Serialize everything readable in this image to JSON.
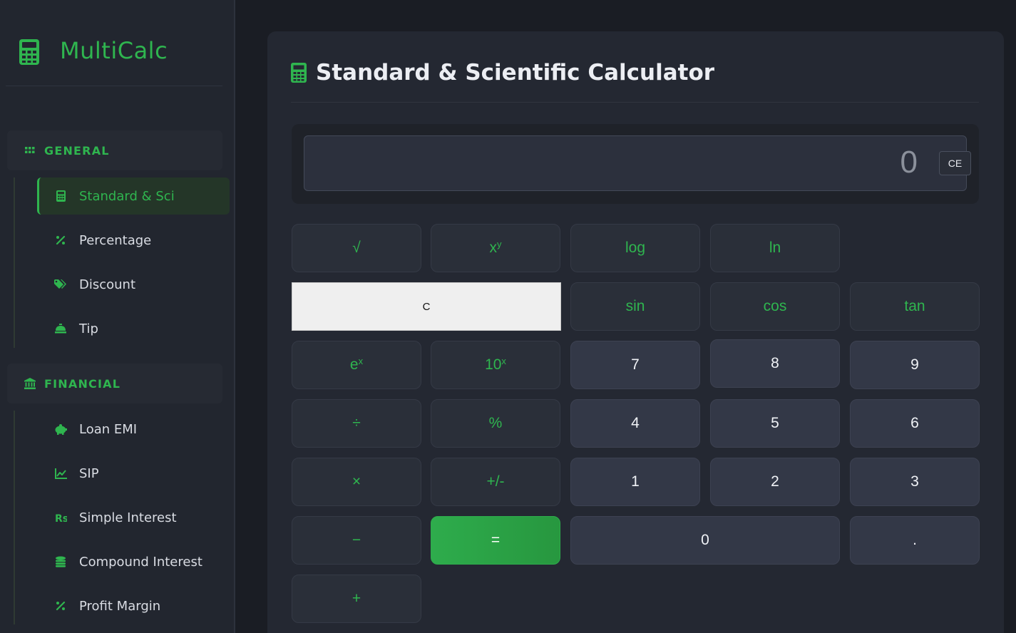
{
  "app": {
    "name": "MultiCalc"
  },
  "sidebar": {
    "sections": [
      {
        "label": "GENERAL",
        "items": [
          {
            "label": "Standard & Sci",
            "icon": "calculator-icon",
            "active": true
          },
          {
            "label": "Percentage",
            "icon": "percent-icon"
          },
          {
            "label": "Discount",
            "icon": "tags-icon"
          },
          {
            "label": "Tip",
            "icon": "bell-concierge-icon"
          }
        ]
      },
      {
        "label": "FINANCIAL",
        "items": [
          {
            "label": "Loan EMI",
            "icon": "piggy-bank-icon"
          },
          {
            "label": "SIP",
            "icon": "chart-line-icon"
          },
          {
            "label": "Simple Interest",
            "icon": "rupee-icon"
          },
          {
            "label": "Compound Interest",
            "icon": "coins-icon"
          },
          {
            "label": "Profit Margin",
            "icon": "percent-icon"
          }
        ]
      }
    ]
  },
  "main": {
    "title": "Standard & Scientific Calculator",
    "display": {
      "value": "0",
      "ce_label": "CE"
    },
    "keys": {
      "sqrt": "√",
      "pow_base": "x",
      "pow_exp": "y",
      "log": "log",
      "ln": "ln",
      "clear": "C",
      "sin": "sin",
      "cos": "cos",
      "tan": "tan",
      "exp_base": "e",
      "exp_exp": "x",
      "tenpow_base": "10",
      "tenpow_exp": "x",
      "seven": "7",
      "eight": "8",
      "nine": "9",
      "divide": "÷",
      "percent": "%",
      "four": "4",
      "five": "5",
      "six": "6",
      "multiply": "×",
      "negate": "+/-",
      "one": "1",
      "two": "2",
      "three": "3",
      "minus": "−",
      "equals": "=",
      "zero": "0",
      "dot": ".",
      "plus": "+"
    }
  },
  "colors": {
    "accent": "#2fb54f",
    "background": "#1a1d24",
    "panel": "#242832"
  }
}
